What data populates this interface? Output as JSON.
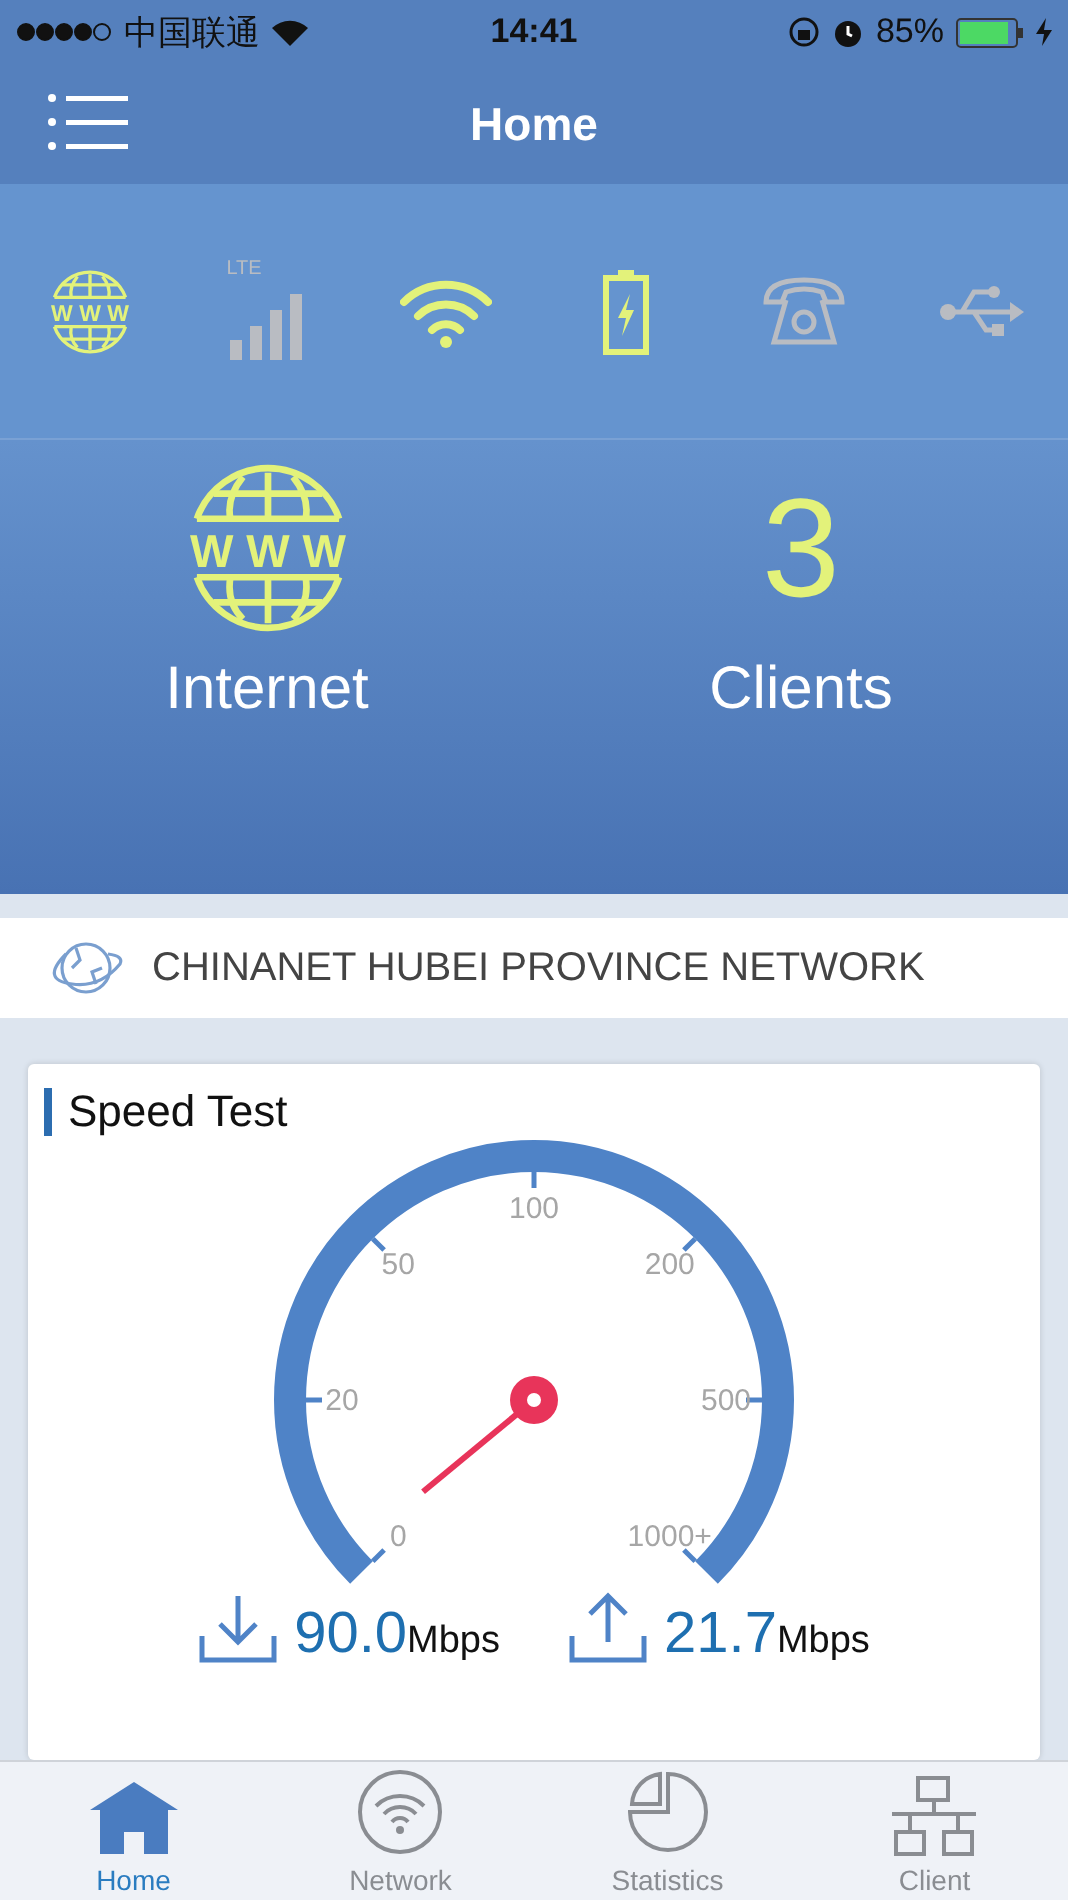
{
  "status_bar": {
    "carrier": "中国联通",
    "time": "14:41",
    "battery": "85%"
  },
  "nav": {
    "title": "Home"
  },
  "indicators": [
    {
      "kind": "globe",
      "label": "W W W",
      "on": true
    },
    {
      "kind": "lte",
      "label": "LTE",
      "on": false
    },
    {
      "kind": "wifi",
      "on": true
    },
    {
      "kind": "battery",
      "on": true
    },
    {
      "kind": "phone",
      "on": false
    },
    {
      "kind": "usb",
      "on": false
    }
  ],
  "hero": {
    "internet": {
      "label": "Internet",
      "icon_text": "W W W",
      "connected": true
    },
    "clients": {
      "count": "3",
      "label": "Clients"
    }
  },
  "network": {
    "name": "CHINANET HUBEI PROVINCE NETWORK"
  },
  "speed_test": {
    "title": "Speed Test",
    "ticks": [
      "0",
      "20",
      "50",
      "100",
      "200",
      "500",
      "1000+"
    ],
    "download": {
      "value": "90.0",
      "unit": "Mbps"
    },
    "upload": {
      "value": "21.7",
      "unit": "Mbps"
    }
  },
  "tabs": [
    {
      "kind": "home",
      "label": "Home",
      "selected": true
    },
    {
      "kind": "network",
      "label": "Network",
      "selected": false
    },
    {
      "kind": "statistics",
      "label": "Statistics",
      "selected": false
    },
    {
      "kind": "client",
      "label": "Client",
      "selected": false
    }
  ]
}
